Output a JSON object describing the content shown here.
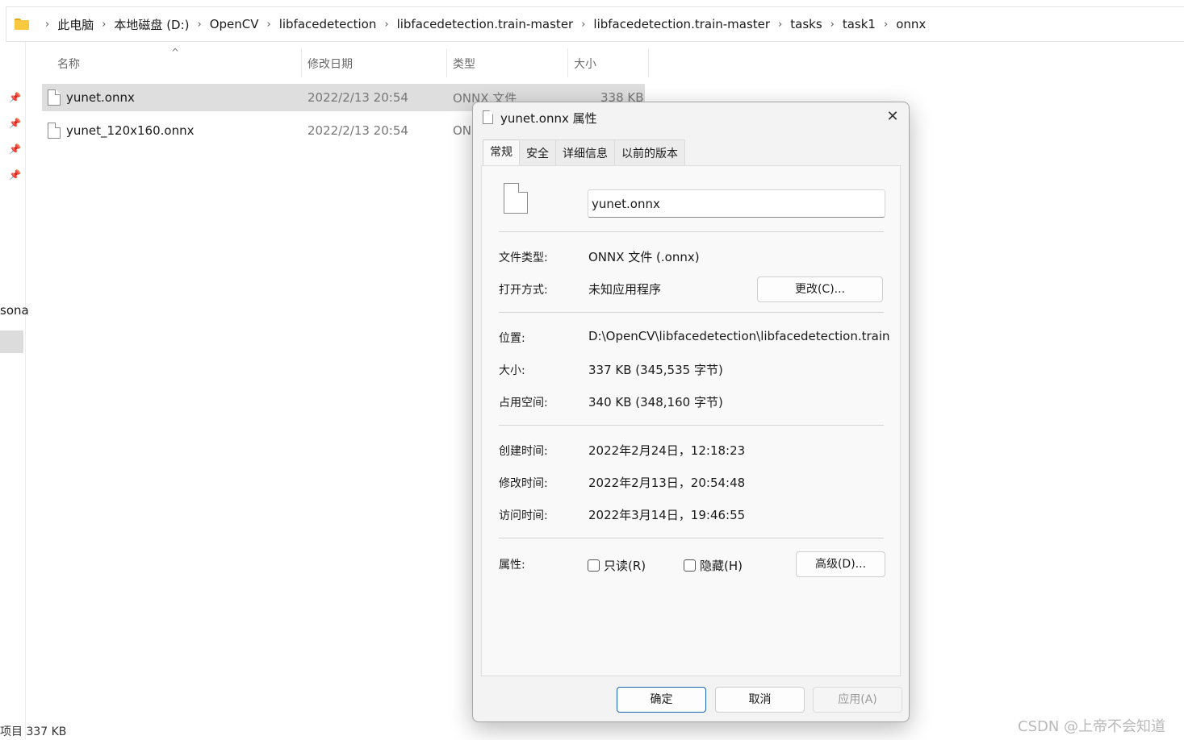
{
  "breadcrumb": [
    "此电脑",
    "本地磁盘 (D:)",
    "OpenCV",
    "libfacedetection",
    "libfacedetection.train-master",
    "libfacedetection.train-master",
    "tasks",
    "task1",
    "onnx"
  ],
  "nav": {
    "partial_label": "sona"
  },
  "columns": {
    "name": "名称",
    "date": "修改日期",
    "type": "类型",
    "size": "大小"
  },
  "files": [
    {
      "name": "yunet.onnx",
      "date": "2022/2/13 20:54",
      "type": "ONNX 文件",
      "size": "338 KB"
    },
    {
      "name": "yunet_120x160.onnx",
      "date": "2022/2/13 20:54",
      "type": "ON",
      "size": ""
    }
  ],
  "status": {
    "text": "项目  337 KB"
  },
  "watermark": "CSDN @上帝不会知道",
  "dialog": {
    "title": "yunet.onnx 属性",
    "close": "✕",
    "tabs": [
      "常规",
      "安全",
      "详细信息",
      "以前的版本"
    ],
    "filename": "yunet.onnx",
    "file_type_label": "文件类型:",
    "file_type": "ONNX 文件 (.onnx)",
    "open_with_label": "打开方式:",
    "open_with": "未知应用程序",
    "change_button": "更改(C)...",
    "location_label": "位置:",
    "location": "D:\\OpenCV\\libfacedetection\\libfacedetection.train",
    "size_label": "大小:",
    "size": "337 KB (345,535 字节)",
    "disk_size_label": "占用空间:",
    "disk_size": "340 KB (348,160 字节)",
    "created_label": "创建时间:",
    "created": "2022年2月24日，12:18:23",
    "modified_label": "修改时间:",
    "modified": "2022年2月13日，20:54:48",
    "accessed_label": "访问时间:",
    "accessed": "2022年3月14日，19:46:55",
    "attributes_label": "属性:",
    "readonly_label": "只读(R)",
    "hidden_label": "隐藏(H)",
    "advanced_button": "高级(D)...",
    "ok_button": "确定",
    "cancel_button": "取消",
    "apply_button": "应用(A)"
  }
}
